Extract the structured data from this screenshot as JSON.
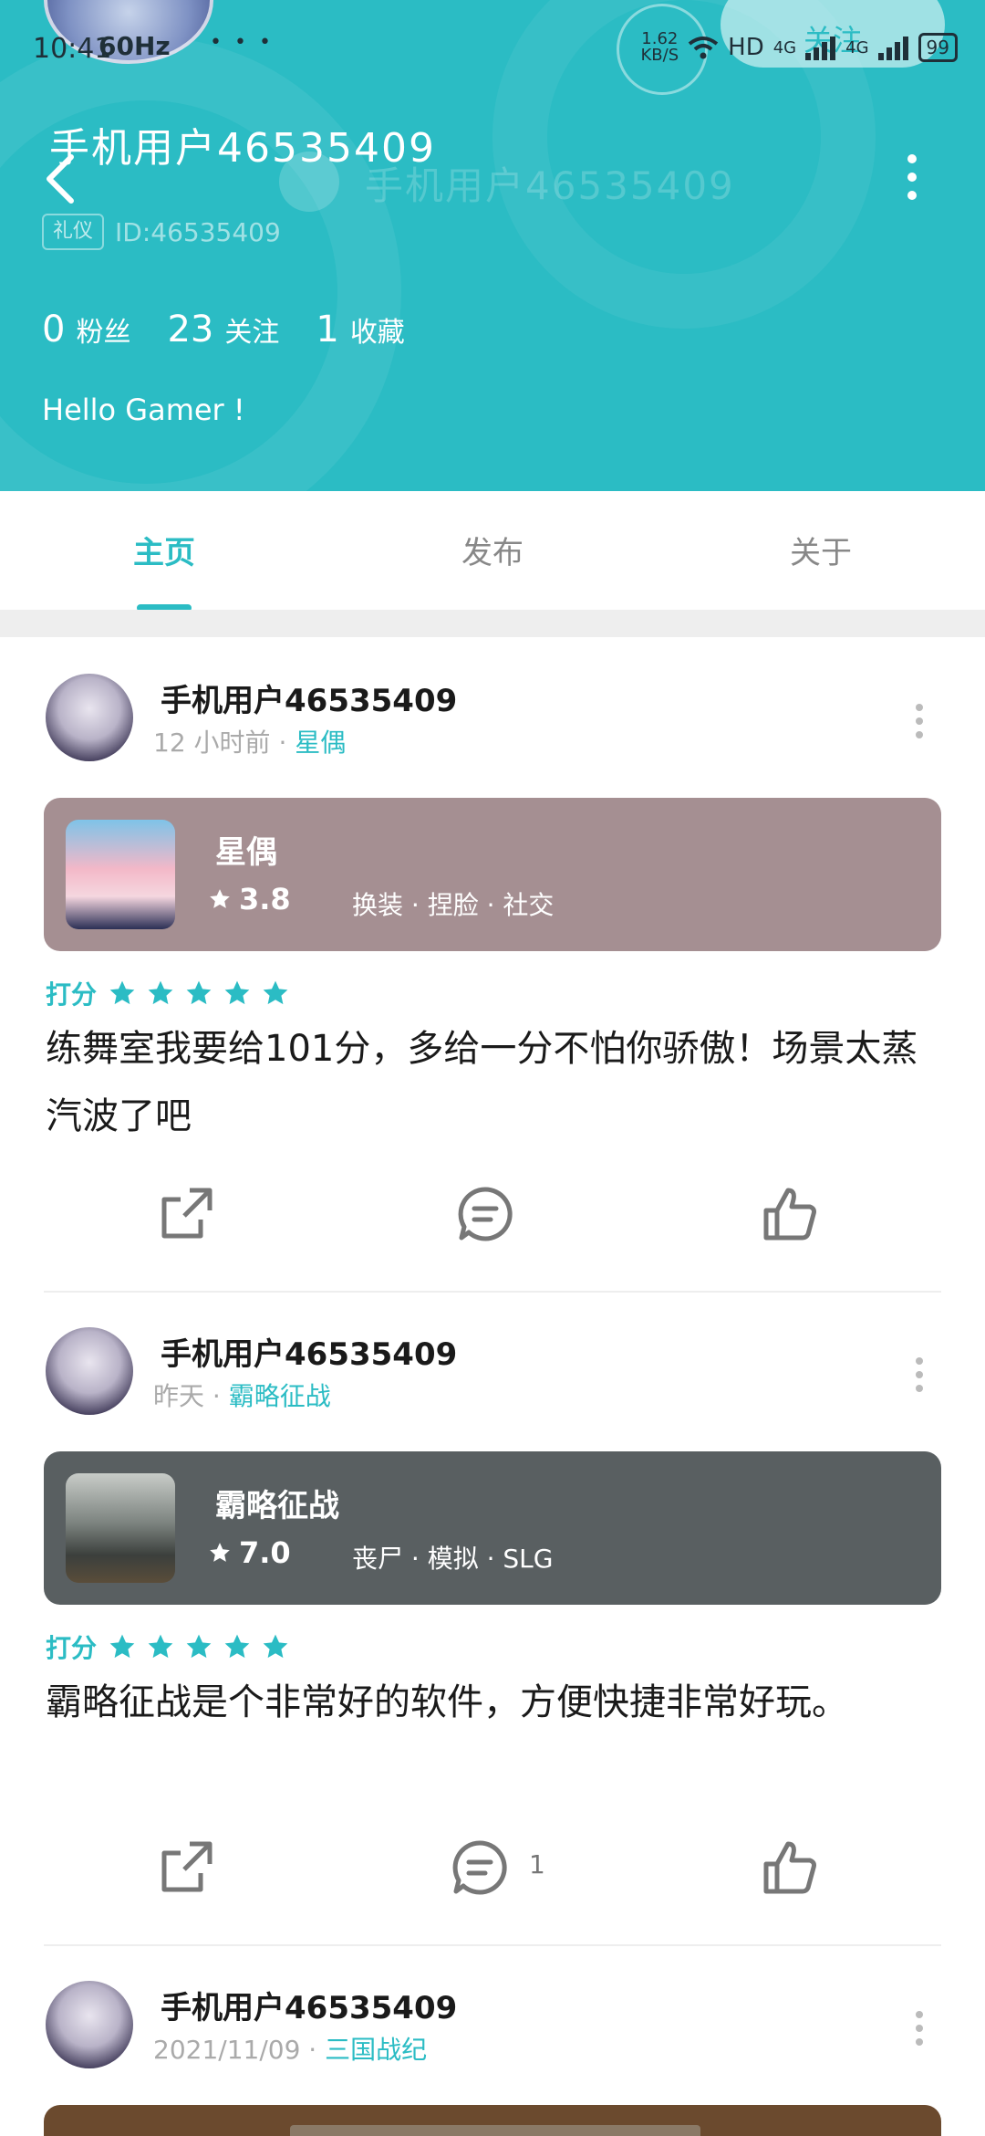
{
  "status_bar": {
    "time": "10:41",
    "refresh": "60Hz",
    "more": "•••",
    "net_speed": "1.62",
    "net_unit": "KB/S",
    "hd": "HD",
    "net_a": "4G",
    "net_b": "4G",
    "battery": "99"
  },
  "header": {
    "follow_label": "关注",
    "username": "手机用户46535409",
    "ghost_username": "手机用户46535409",
    "badge": "礼仪",
    "user_id": "ID:46535409",
    "stats": [
      {
        "num": "0",
        "label": "粉丝"
      },
      {
        "num": "23",
        "label": "关注"
      },
      {
        "num": "1",
        "label": "收藏"
      }
    ],
    "bio": "Hello Gamer !"
  },
  "tabs": [
    {
      "label": "主页",
      "active": true
    },
    {
      "label": "发布",
      "active": false
    },
    {
      "label": "关于",
      "active": false
    }
  ],
  "posts": [
    {
      "author": "手机用户46535409",
      "time": "12 小时前",
      "separator": "·",
      "game_link": "星偶",
      "game": {
        "name": "星偶",
        "rating": "3.8",
        "tags": "换装 · 捏脸 · 社交",
        "card_color": "#a58f92"
      },
      "score_label": "打分",
      "stars": 5,
      "text": "练舞室我要给101分，多给一分不怕你骄傲！场景太蒸汽波了吧",
      "comment_count": ""
    },
    {
      "author": "手机用户46535409",
      "time": "昨天",
      "separator": "·",
      "game_link": "霸略征战",
      "game": {
        "name": "霸略征战",
        "rating": "7.0",
        "tags": "丧尸 · 模拟 · SLG",
        "card_color": "#595f61"
      },
      "score_label": "打分",
      "stars": 5,
      "text": "霸略征战是个非常好的软件，方便快捷非常好玩。",
      "comment_count": "1"
    },
    {
      "author": "手机用户46535409",
      "time": "2021/11/09",
      "separator": "·",
      "game_link": "三国战纪"
    }
  ],
  "colors": {
    "accent": "#2bbcc4",
    "header_bg": "#2bbcc4"
  }
}
